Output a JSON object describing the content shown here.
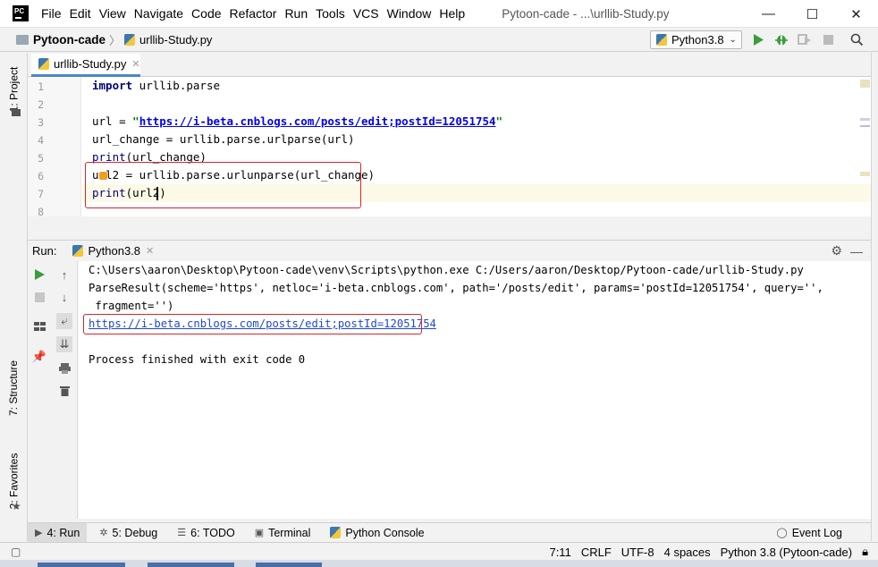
{
  "app": {
    "logo_text": "PC",
    "window_title": "Pytoon-cade - ...\\urllib-Study.py"
  },
  "menu": [
    "File",
    "Edit",
    "View",
    "Navigate",
    "Code",
    "Refactor",
    "Run",
    "Tools",
    "VCS",
    "Window",
    "Help"
  ],
  "window_controls": {
    "minimize": "—",
    "maximize": "☐",
    "close": "✕"
  },
  "breadcrumb": {
    "project": "Pytoon-cade",
    "file": "urllib-Study.py"
  },
  "run_config": {
    "label": "Python3.8"
  },
  "left_tabs": {
    "project": "1: Project",
    "structure": "7: Structure",
    "favorites": "2: Favorites"
  },
  "editor": {
    "tab_label": "urllib-Study.py",
    "line_numbers": [
      "1",
      "2",
      "3",
      "4",
      "5",
      "6",
      "7",
      "8"
    ],
    "lines": {
      "l1_kw": "import",
      "l1_rest": " urllib.parse",
      "l3_a": "url = ",
      "l3_q1": "\"",
      "l3_url": "https://i-beta.cnblogs.com/posts/edit;postId=12051754",
      "l3_q2": "\"",
      "l4": "url_change = urllib.parse.urlparse(url)",
      "l5_fn": "print",
      "l5_rest": "(url_change)",
      "l6": "url2 = urllib.parse.urlunparse(url_change)",
      "l7_fn": "print",
      "l7_rest": "(url2)"
    }
  },
  "run_panel": {
    "label": "Run:",
    "tab": "Python3.8",
    "console": {
      "cmd": "C:\\Users\\aaron\\Desktop\\Pytoon-cade\\venv\\Scripts\\python.exe C:/Users/aaron/Desktop/Pytoon-cade/urllib-Study.py",
      "result1": "ParseResult(scheme='https', netloc='i-beta.cnblogs.com', path='/posts/edit', params='postId=12051754', query='',",
      "result2": " fragment='')",
      "output_url": "https://i-beta.cnblogs.com/posts/edit;postId=12051754",
      "exit": "Process finished with exit code 0"
    }
  },
  "bottom_tabs": {
    "run": "4: Run",
    "debug": "5: Debug",
    "todo": "6: TODO",
    "terminal": "Terminal",
    "python_console": "Python Console",
    "event_log": "Event Log"
  },
  "status": {
    "position": "7:11",
    "line_sep": "CRLF",
    "encoding": "UTF-8",
    "indent": "4 spaces",
    "interpreter": "Python 3.8 (Pytoon-cade)"
  },
  "colors": {
    "accent": "#4a88c7",
    "highlight_box": "#d9252a",
    "run_green": "#3d9b3d",
    "link": "#1f48d7"
  },
  "icons": [
    "run-icon",
    "debug-icon",
    "coverage-icon",
    "stop-icon",
    "search-icon",
    "settings-icon",
    "minimize-icon"
  ]
}
